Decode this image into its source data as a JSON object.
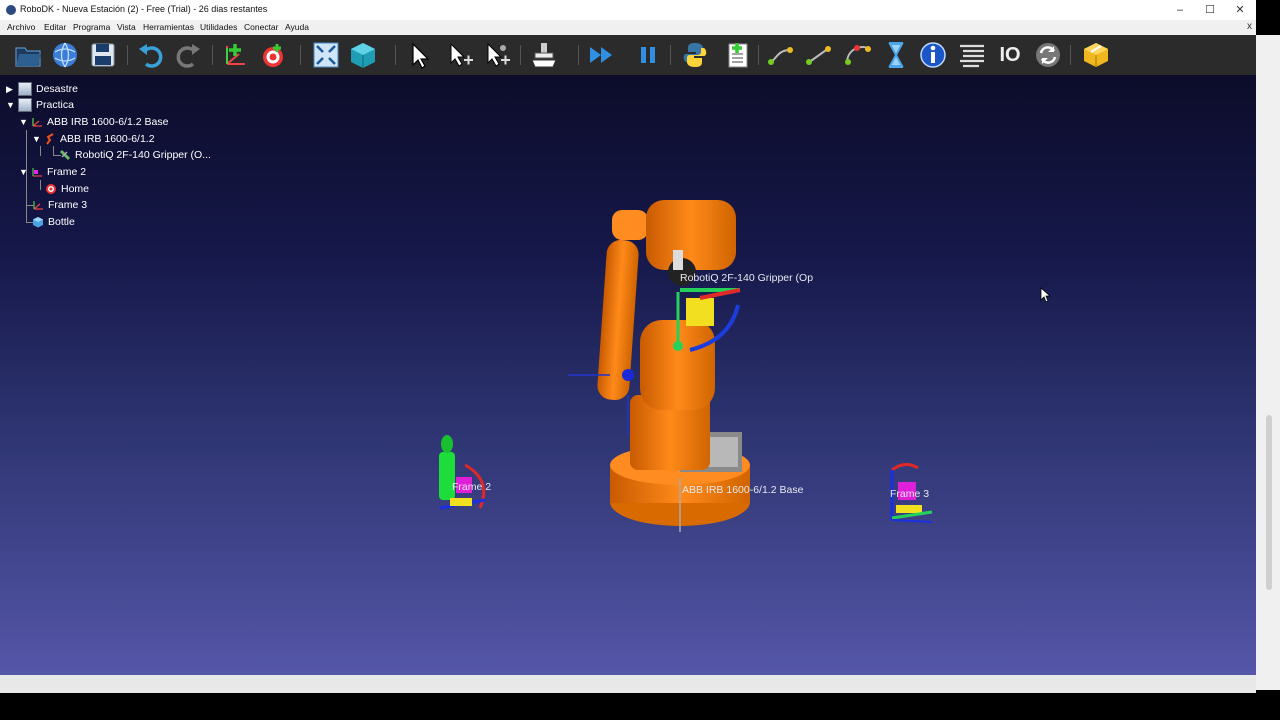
{
  "window": {
    "title": "RoboDK - Nueva Estación (2) - Free (Trial) - 26 dias restantes",
    "minimize": "–",
    "maximize": "☐",
    "close": "✕"
  },
  "menu": {
    "items": [
      "Archivo",
      "Editar",
      "Programa",
      "Vista",
      "Herramientas",
      "Utilidades",
      "Conectar",
      "Ayuda"
    ],
    "close": "x"
  },
  "toolbar": {
    "io_label": "IO"
  },
  "tree": {
    "items": [
      {
        "label": "Desastre"
      },
      {
        "label": "Practica"
      },
      {
        "label": "ABB IRB 1600-6/1.2 Base"
      },
      {
        "label": "ABB IRB 1600-6/1.2"
      },
      {
        "label": "RobotiQ 2F-140 Gripper (O..."
      },
      {
        "label": "Frame 2"
      },
      {
        "label": "Home"
      },
      {
        "label": "Frame 3"
      },
      {
        "label": "Bottle"
      }
    ]
  },
  "scene": {
    "gripper_label": "RobotiQ 2F-140 Gripper (Op",
    "base_label": "ABB IRB 1600-6/1.2 Base",
    "frame2_label": "Frame 2",
    "frame3_label": "Frame 3"
  },
  "colors": {
    "robot": "#f07f10",
    "background_top": "#0c0c2a",
    "background_bottom": "#5556a8"
  }
}
